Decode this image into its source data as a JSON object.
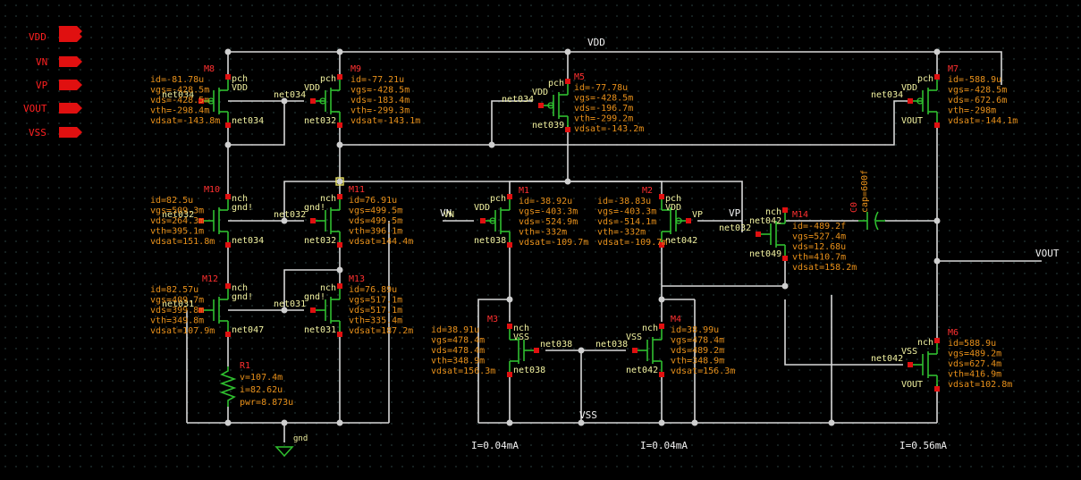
{
  "pins": {
    "vdd": "VDD",
    "vn": "VN",
    "vp": "VP",
    "vout": "VOUT",
    "vss": "VSS"
  },
  "nets": {
    "vdd_top": "VDD",
    "vss_bot": "VSS",
    "vn_wire": "VN",
    "vp_wire": "VP",
    "vout_wire": "VOUT",
    "gnd": "gnd"
  },
  "currents": {
    "i1": "I=0.04mA",
    "i2": "I=0.04mA",
    "i3": "I=0.56mA"
  },
  "devices": {
    "M8": {
      "name": "M8",
      "type": "pch",
      "g": "net034",
      "s": "VDD",
      "d": "net034",
      "params": [
        "id=-81.78u",
        "vgs=-428.5m",
        "vds=-428.5m",
        "vth=-298.4m",
        "vdsat=-143.8m"
      ]
    },
    "M9": {
      "name": "M9",
      "type": "pch",
      "g": "net034",
      "s": "VDD",
      "d": "net032",
      "params": [
        "id=-77.21u",
        "vgs=-428.5m",
        "vds=-183.4m",
        "vth=-299.3m",
        "vdsat=-143.1m"
      ]
    },
    "M5": {
      "name": "M5",
      "type": "pch",
      "g": "net034",
      "s": "VDD",
      "d": "net039",
      "params": [
        "id=-77.78u",
        "vgs=-428.5m",
        "vds=-196.7m",
        "vth=-299.2m",
        "vdsat=-143.2m"
      ]
    },
    "M7": {
      "name": "M7",
      "type": "pch",
      "g": "net034",
      "s": "VDD",
      "d": "VOUT",
      "params": [
        "id=-588.9u",
        "vgs=-428.5m",
        "vds=-672.6m",
        "vth=-298m",
        "vdsat=-144.1m"
      ]
    },
    "M10": {
      "name": "M10",
      "type": "nch",
      "g": "net032",
      "s": "gnd!",
      "d": "net034",
      "params": [
        "id=82.5u",
        "vgs=509.3m",
        "vds=264.3m",
        "vth=395.1m",
        "vdsat=151.8m"
      ]
    },
    "M11": {
      "name": "M11",
      "type": "nch",
      "g": "net032",
      "s": "gnd!",
      "d": "net032",
      "params": [
        "id=76.91u",
        "vgs=499.5m",
        "vds=499.5m",
        "vth=396.1m",
        "vdsat=144.4m"
      ]
    },
    "M12": {
      "name": "M12",
      "type": "nch",
      "g": "net031",
      "s": "gnd!",
      "d": "net047",
      "params": [
        "id=82.57u",
        "vgs=409.7m",
        "vds=399.8m",
        "vth=349.8m",
        "vdsat=107.9m"
      ]
    },
    "M13": {
      "name": "M13",
      "type": "nch",
      "g": "net031",
      "s": "gnd!",
      "d": "net031",
      "params": [
        "id=76.89u",
        "vgs=517.1m",
        "vds=517.1m",
        "vth=335.4m",
        "vdsat=187.2m"
      ]
    },
    "M1": {
      "name": "M1",
      "type": "pch",
      "g": "VN",
      "s": "net039",
      "d": "net038",
      "b": "VDD",
      "params": [
        "id=-38.92u",
        "vgs=-403.3m",
        "vds=-524.9m",
        "vth=-332m",
        "vdsat=-109.7m"
      ]
    },
    "M2": {
      "name": "M2",
      "type": "pch",
      "g": "VP",
      "s": "net039",
      "d": "net042",
      "b": "VDD",
      "params": [
        "id=-38.83u",
        "vgs=-403.3m",
        "vds=-514.1m",
        "vth=-332m",
        "vdsat=-109.7m"
      ]
    },
    "M3": {
      "name": "M3",
      "type": "nch",
      "g": "net038",
      "s": "VSS",
      "d": "net038",
      "params": [
        "id=38.91u",
        "vgs=478.4m",
        "vds=478.4m",
        "vth=348.9m",
        "vdsat=156.3m"
      ]
    },
    "M4": {
      "name": "M4",
      "type": "nch",
      "g": "net038",
      "s": "VSS",
      "d": "net042",
      "params": [
        "id=38.99u",
        "vgs=478.4m",
        "vds=489.2m",
        "vth=348.9m",
        "vdsat=156.3m"
      ]
    },
    "M14": {
      "name": "M14",
      "type": "nch",
      "g": "net032",
      "s": "VSS",
      "d": "net049",
      "b": "net042",
      "params": [
        "id=-489.2f",
        "vgs=527.4m",
        "vds=12.68u",
        "vth=410.7m",
        "vdsat=158.2m"
      ]
    },
    "M6": {
      "name": "M6",
      "type": "nch",
      "g": "net042",
      "s": "VSS",
      "d": "VOUT",
      "params": [
        "id=588.9u",
        "vgs=489.2m",
        "vds=627.4m",
        "vth=416.9m",
        "vdsat=102.8m"
      ]
    },
    "R1": {
      "name": "R1",
      "params": [
        "v=107.4m",
        "i=82.62u",
        "pwr=8.873u"
      ]
    },
    "C0": {
      "name": "C0",
      "params": [
        "cap=600f"
      ]
    }
  }
}
